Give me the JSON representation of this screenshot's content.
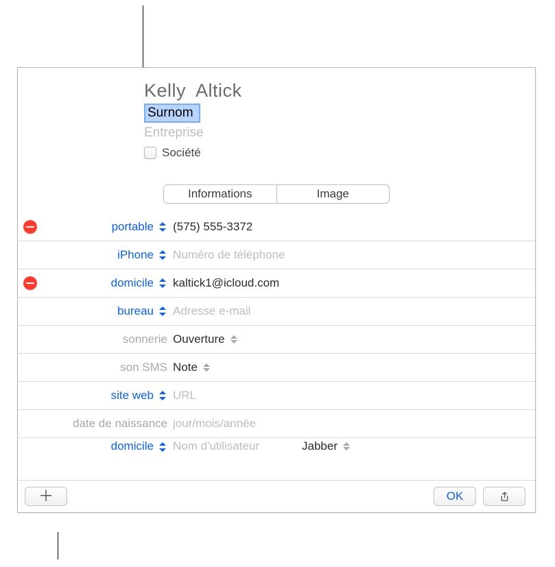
{
  "firstName": "Kelly",
  "lastName": "Altick",
  "nicknameField": "Surnom",
  "companyPlaceholder": "Entreprise",
  "companyCheckboxLabel": "Société",
  "tabs": {
    "info": "Informations",
    "image": "Image"
  },
  "rows": {
    "phone1": {
      "label": "portable",
      "value": "(575) 555-3372"
    },
    "phone2": {
      "label": "iPhone",
      "placeholder": "Numéro de téléphone"
    },
    "email1": {
      "label": "domicile",
      "value": "kaltick1@icloud.com"
    },
    "email2": {
      "label": "bureau",
      "placeholder": "Adresse e-mail"
    },
    "ringtone": {
      "label": "sonnerie",
      "value": "Ouverture"
    },
    "texttone": {
      "label": "son SMS",
      "value": "Note"
    },
    "url": {
      "label": "site web",
      "placeholder": "URL"
    },
    "birthday": {
      "label": "date de naissance",
      "placeholder": "jour/mois/année"
    },
    "peek": {
      "label": "domicile",
      "placeholder": "Nom d'utilisateur",
      "service": "Jabber"
    }
  },
  "footer": {
    "ok": "OK"
  }
}
